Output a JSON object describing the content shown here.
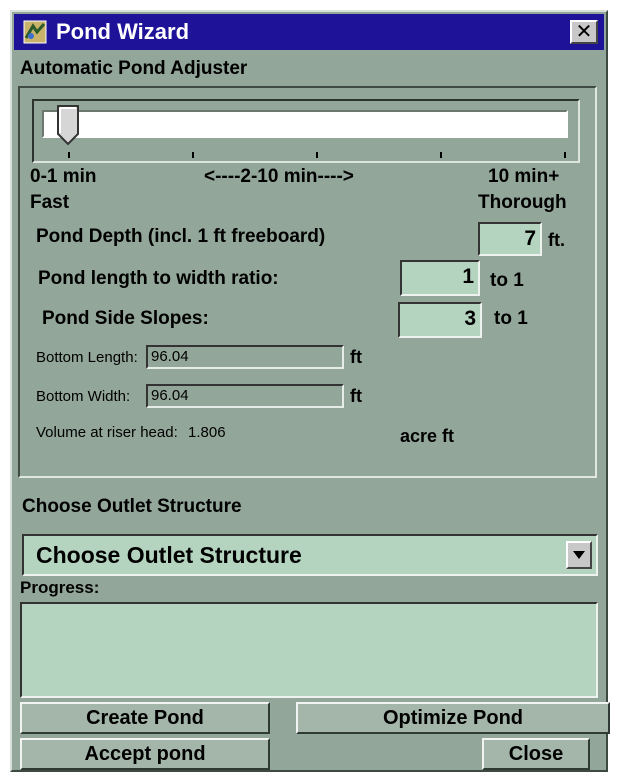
{
  "window": {
    "title": "Pond Wizard",
    "close_label": "✕"
  },
  "adjuster": {
    "heading": "Automatic Pond Adjuster",
    "slider_value": 0,
    "label_fast_time": "0-1 min",
    "label_mid_time": "<----2-10 min---->",
    "label_slow_time": "10 min+",
    "label_fast": "Fast",
    "label_thorough": "Thorough"
  },
  "depth": {
    "label": "Pond Depth (incl. 1 ft freeboard)",
    "value": "7",
    "unit": "ft."
  },
  "ratio": {
    "label": "Pond length to width ratio:",
    "value": "1",
    "unit": "to 1"
  },
  "slopes": {
    "label": "Pond Side Slopes:",
    "value": "3",
    "unit": "to 1"
  },
  "bottom_length": {
    "label": "Bottom Length:",
    "value": "96.04",
    "unit": "ft"
  },
  "bottom_width": {
    "label": "Bottom Width:",
    "value": "96.04",
    "unit": "ft"
  },
  "volume": {
    "label": "Volume at riser head:",
    "value": "1.806",
    "unit": "acre ft"
  },
  "outlet": {
    "heading": "Choose Outlet Structure",
    "selected": "Choose Outlet Structure"
  },
  "progress": {
    "label": "Progress:",
    "text": ""
  },
  "buttons": {
    "create": "Create Pond",
    "optimize": "Optimize Pond",
    "accept": "Accept pond",
    "close": "Close"
  },
  "colors": {
    "titlebar": "#1e1299",
    "panel": "#93a69a",
    "field": "#b4d4bf"
  }
}
